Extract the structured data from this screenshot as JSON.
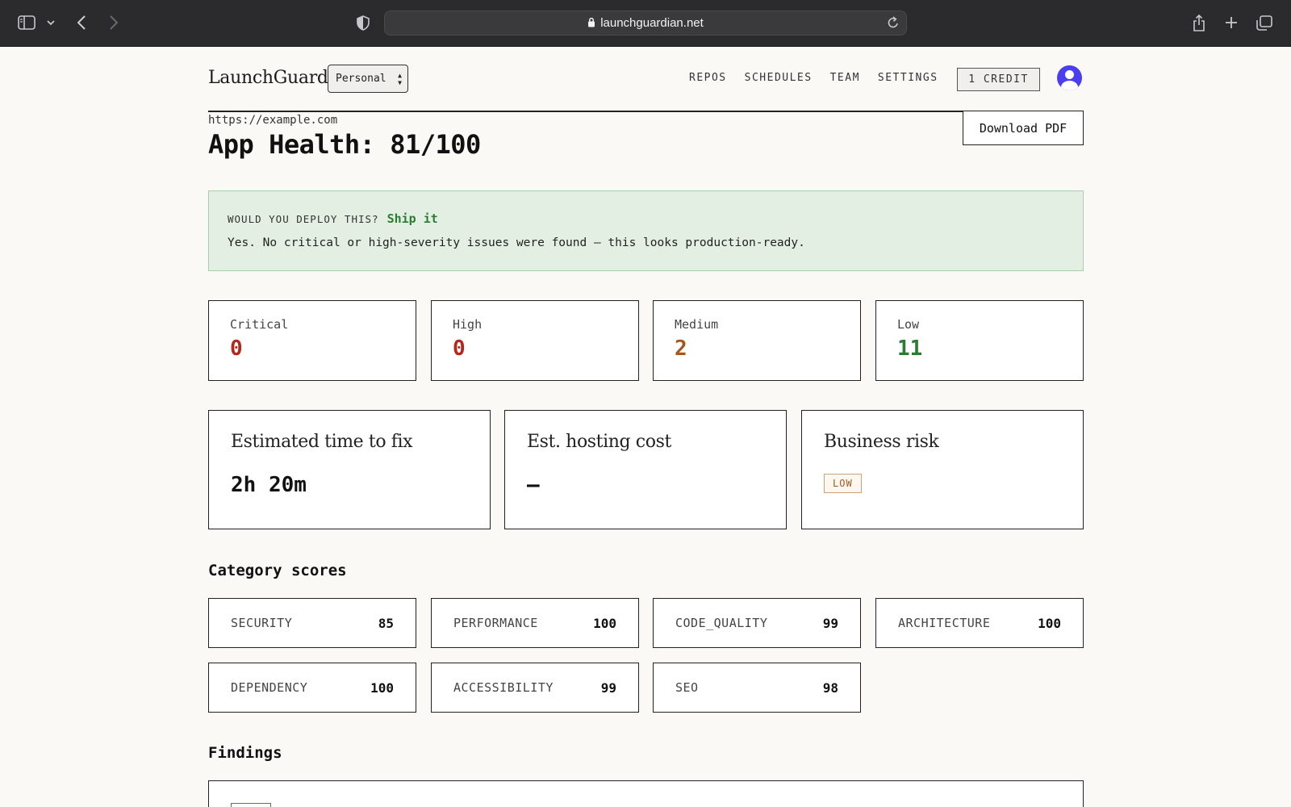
{
  "browser": {
    "url": "launchguardian.net"
  },
  "nav": {
    "brand": "LaunchGuard",
    "workspace": "Personal",
    "links": [
      "REPOS",
      "SCHEDULES",
      "TEAM",
      "SETTINGS"
    ],
    "credit": "1 CREDIT"
  },
  "report": {
    "site_url": "https://example.com",
    "title": "App Health: 81/100",
    "download_label": "Download PDF"
  },
  "verdict": {
    "question": "WOULD YOU DEPLOY THIS?",
    "answer": "Ship it",
    "message": "Yes. No critical or high-severity issues were found — this looks production-ready."
  },
  "severity": [
    {
      "label": "Critical",
      "count": "0",
      "color": "#b8261b"
    },
    {
      "label": "High",
      "count": "0",
      "color": "#b8261b"
    },
    {
      "label": "Medium",
      "count": "2",
      "color": "#a8561b"
    },
    {
      "label": "Low",
      "count": "11",
      "color": "#2a7d33"
    }
  ],
  "summary": {
    "time_to_fix_label": "Estimated time to fix",
    "time_to_fix_value": "2h 20m",
    "hosting_label": "Est. hosting cost",
    "hosting_value": "—",
    "risk_label": "Business risk",
    "risk_value": "LOW"
  },
  "categories": {
    "title": "Category scores",
    "items": [
      {
        "name": "SECURITY",
        "score": "85"
      },
      {
        "name": "PERFORMANCE",
        "score": "100"
      },
      {
        "name": "CODE_QUALITY",
        "score": "99"
      },
      {
        "name": "ARCHITECTURE",
        "score": "100"
      },
      {
        "name": "DEPENDENCY",
        "score": "100"
      },
      {
        "name": "ACCESSIBILITY",
        "score": "99"
      },
      {
        "name": "SEO",
        "score": "98"
      }
    ]
  },
  "findings": {
    "title": "Findings"
  }
}
